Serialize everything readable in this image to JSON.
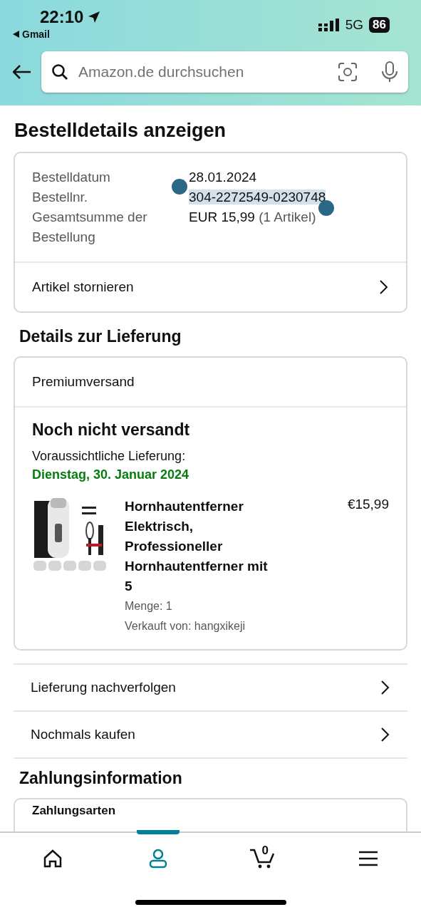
{
  "status_bar": {
    "time": "22:10",
    "back_app": "Gmail",
    "network": "5G",
    "battery": "86"
  },
  "search": {
    "placeholder": "Amazon.de durchsuchen"
  },
  "page_title": "Bestelldetails anzeigen",
  "order_summary": {
    "rows": [
      {
        "label": "Bestelldatum",
        "value": "28.01.2024",
        "selected": false
      },
      {
        "label": "Bestellnr.",
        "value": "304-2272549-0230748",
        "selected": true
      },
      {
        "label": "Gesamtsumme der Bestellung",
        "value": "EUR 15,99",
        "note": "(1 Artikel)",
        "selected": false
      }
    ],
    "action": "Artikel stornieren"
  },
  "delivery": {
    "title": "Details zur Lieferung",
    "shipping": "Premiumversand",
    "status": "Noch nicht versandt",
    "eta_label": "Voraussichtliche Lieferung:",
    "eta_date": "Dienstag, 30. Januar 2024",
    "item": {
      "kind": "picture",
      "title": "Hornhautentferner Elektrisch, Professioneller Hornhautentferner mit 5",
      "price": "€15,99",
      "quantity": "Menge: 1",
      "seller": "Verkauft von: hangxikeji"
    }
  },
  "links": [
    "Lieferung nachverfolgen",
    "Nochmals kaufen"
  ],
  "payment": {
    "title": "Zahlungsinformation",
    "heading": "Zahlungsarten"
  },
  "tabs": [
    {
      "kind": "home",
      "selected": false
    },
    {
      "kind": "account",
      "selected": true
    },
    {
      "kind": "cart",
      "count": "0",
      "selected": false
    },
    {
      "kind": "menu",
      "selected": false
    }
  ]
}
